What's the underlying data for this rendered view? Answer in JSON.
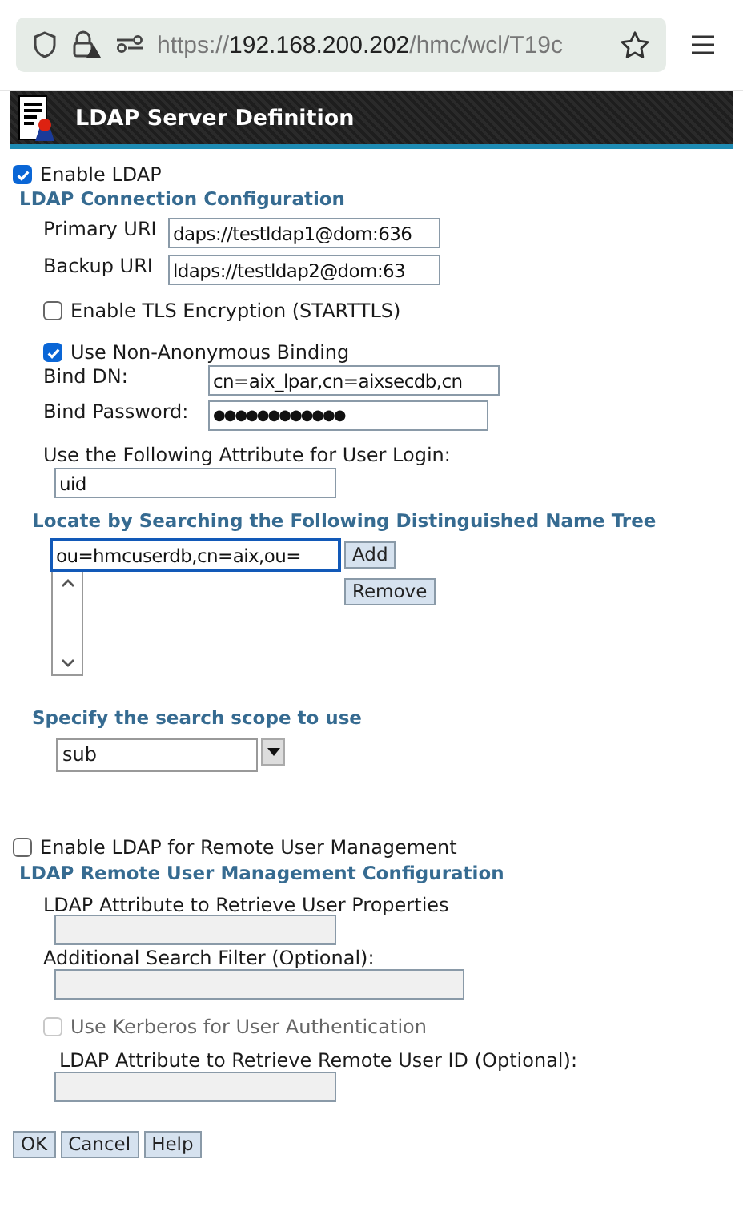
{
  "browser": {
    "url_scheme": "https://",
    "url_host": "192.168.200.202",
    "url_path": "/hmc/wcl/T19c"
  },
  "header": {
    "title": "LDAP Server Definition"
  },
  "enable_ldap": {
    "label": "Enable LDAP",
    "checked": true
  },
  "connection": {
    "heading": "LDAP Connection Configuration",
    "primary_uri": {
      "label": "Primary URI",
      "value": "daps://testldap1@dom:636"
    },
    "backup_uri": {
      "label": "Backup URI",
      "value": "ldaps://testldap2@dom:63"
    },
    "tls": {
      "label": "Enable TLS Encryption (STARTTLS)",
      "checked": false
    },
    "non_anonymous": {
      "label": "Use Non-Anonymous Binding",
      "checked": true
    },
    "bind_dn": {
      "label": "Bind DN:",
      "value": "cn=aix_lpar,cn=aixsecdb,cn"
    },
    "bind_password": {
      "label": "Bind Password:",
      "value": "●●●●●●●●●●●●"
    },
    "login_attribute": {
      "label": "Use the Following Attribute for User Login:",
      "value": "uid"
    }
  },
  "dn_tree": {
    "heading": "Locate by Searching the Following Distinguished Name Tree",
    "value": "ou=hmcuserdb,cn=aix,ou=",
    "add": "Add",
    "remove": "Remove"
  },
  "scope": {
    "heading": "Specify the search scope to use",
    "value": "sub"
  },
  "remote": {
    "enable": {
      "label": "Enable LDAP for Remote User Management",
      "checked": false
    },
    "heading": "LDAP Remote User Management Configuration",
    "user_properties": {
      "label": "LDAP Attribute to Retrieve User Properties",
      "disabled": true
    },
    "search_filter": {
      "label": "Additional Search Filter (Optional):",
      "disabled": true
    },
    "kerberos": {
      "label": "Use Kerberos for User Authentication",
      "checked": false,
      "disabled": true
    },
    "remote_user_id": {
      "label": "LDAP Attribute to Retrieve Remote User ID (Optional):",
      "disabled": true
    }
  },
  "buttons": [
    "OK",
    "Cancel",
    "Help"
  ]
}
